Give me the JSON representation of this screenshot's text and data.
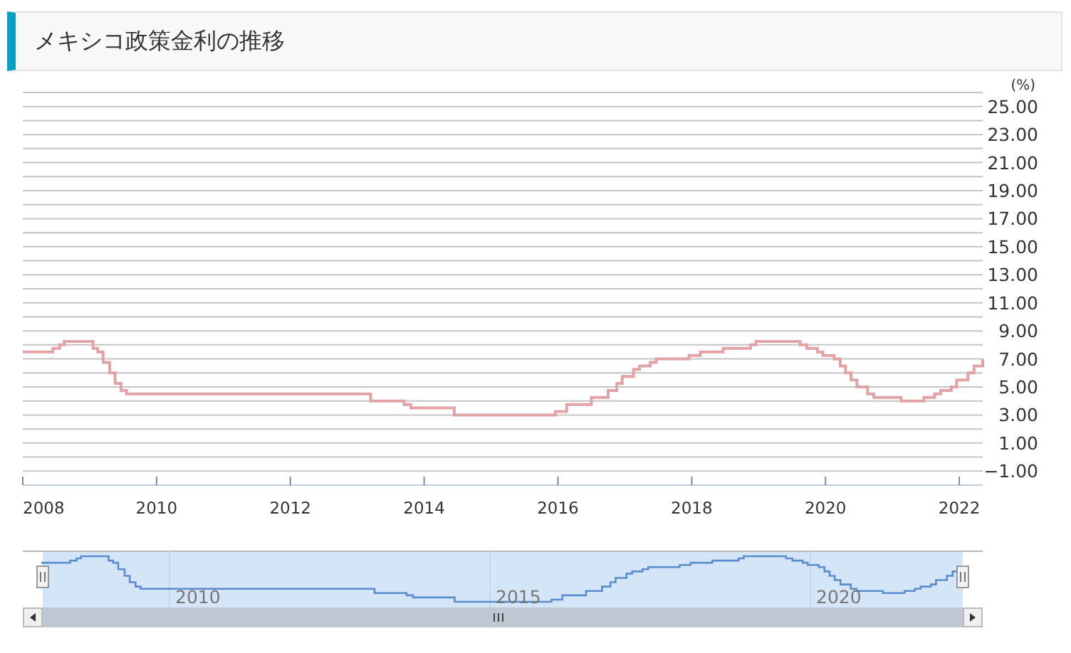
{
  "header": {
    "title": "メキシコ政策金利の推移"
  },
  "chart": {
    "unit": "(%)",
    "chart_data": {
      "type": "line",
      "x": [
        2008.0,
        2008.45,
        2008.45,
        2008.55,
        2008.55,
        2008.62,
        2008.62,
        2009.05,
        2009.05,
        2009.12,
        2009.12,
        2009.2,
        2009.2,
        2009.3,
        2009.3,
        2009.38,
        2009.38,
        2009.47,
        2009.47,
        2009.55,
        2009.55,
        2013.2,
        2013.2,
        2013.7,
        2013.7,
        2013.8,
        2013.8,
        2014.45,
        2014.45,
        2015.96,
        2015.96,
        2016.13,
        2016.13,
        2016.5,
        2016.5,
        2016.75,
        2016.75,
        2016.88,
        2016.88,
        2016.96,
        2016.96,
        2017.13,
        2017.13,
        2017.22,
        2017.22,
        2017.38,
        2017.38,
        2017.47,
        2017.47,
        2017.96,
        2017.96,
        2018.13,
        2018.13,
        2018.47,
        2018.47,
        2018.88,
        2018.88,
        2018.96,
        2018.96,
        2019.62,
        2019.62,
        2019.72,
        2019.72,
        2019.88,
        2019.88,
        2019.96,
        2019.96,
        2020.13,
        2020.13,
        2020.22,
        2020.22,
        2020.3,
        2020.3,
        2020.38,
        2020.38,
        2020.47,
        2020.47,
        2020.63,
        2020.63,
        2020.72,
        2020.72,
        2021.13,
        2021.13,
        2021.47,
        2021.47,
        2021.63,
        2021.63,
        2021.72,
        2021.72,
        2021.88,
        2021.88,
        2021.96,
        2021.96,
        2022.13,
        2022.13,
        2022.22,
        2022.22,
        2022.35,
        2022.35
      ],
      "series": [
        {
          "color": "#e2a3a6",
          "values": [
            7.5,
            7.5,
            7.75,
            7.75,
            8.0,
            8.0,
            8.25,
            8.25,
            7.75,
            7.75,
            7.5,
            7.5,
            6.75,
            6.75,
            6.0,
            6.0,
            5.25,
            5.25,
            4.75,
            4.75,
            4.5,
            4.5,
            4.0,
            4.0,
            3.75,
            3.75,
            3.5,
            3.5,
            3.0,
            3.0,
            3.25,
            3.25,
            3.75,
            3.75,
            4.25,
            4.25,
            4.75,
            4.75,
            5.25,
            5.25,
            5.75,
            5.75,
            6.25,
            6.25,
            6.5,
            6.5,
            6.75,
            6.75,
            7.0,
            7.0,
            7.25,
            7.25,
            7.5,
            7.5,
            7.75,
            7.75,
            8.0,
            8.0,
            8.25,
            8.25,
            8.0,
            8.0,
            7.75,
            7.75,
            7.5,
            7.5,
            7.25,
            7.25,
            7.0,
            7.0,
            6.5,
            6.5,
            6.0,
            6.0,
            5.5,
            5.5,
            5.0,
            5.0,
            4.5,
            4.5,
            4.25,
            4.25,
            4.0,
            4.0,
            4.25,
            4.25,
            4.5,
            4.5,
            4.75,
            4.75,
            5.0,
            5.0,
            5.5,
            5.5,
            6.0,
            6.0,
            6.5,
            6.5,
            7.0
          ]
        }
      ],
      "grid": true,
      "xlim": [
        2008,
        2022.35
      ],
      "ylim": [
        -2,
        26
      ],
      "xticks": [
        {
          "value": 2008,
          "label": "2008"
        },
        {
          "value": 2010,
          "label": "2010"
        },
        {
          "value": 2012,
          "label": "2012"
        },
        {
          "value": 2014,
          "label": "2014"
        },
        {
          "value": 2016,
          "label": "2016"
        },
        {
          "value": 2018,
          "label": "2018"
        },
        {
          "value": 2020,
          "label": "2020"
        },
        {
          "value": 2022,
          "label": "2022"
        }
      ],
      "yticks": [
        {
          "value": 25,
          "label": "25.00"
        },
        {
          "value": 23,
          "label": "23.00"
        },
        {
          "value": 21,
          "label": "21.00"
        },
        {
          "value": 19,
          "label": "19.00"
        },
        {
          "value": 17,
          "label": "17.00"
        },
        {
          "value": 15,
          "label": "15.00"
        },
        {
          "value": 13,
          "label": "13.00"
        },
        {
          "value": 11,
          "label": "11.00"
        },
        {
          "value": 9,
          "label": "9.00"
        },
        {
          "value": 7,
          "label": "7.00"
        },
        {
          "value": 5,
          "label": "5.00"
        },
        {
          "value": 3,
          "label": "3.00"
        },
        {
          "value": 1,
          "label": "1.00"
        },
        {
          "value": -1,
          "label": "−1.00"
        }
      ]
    }
  },
  "navigator": {
    "labels": [
      "2010",
      "2015",
      "2020"
    ]
  }
}
